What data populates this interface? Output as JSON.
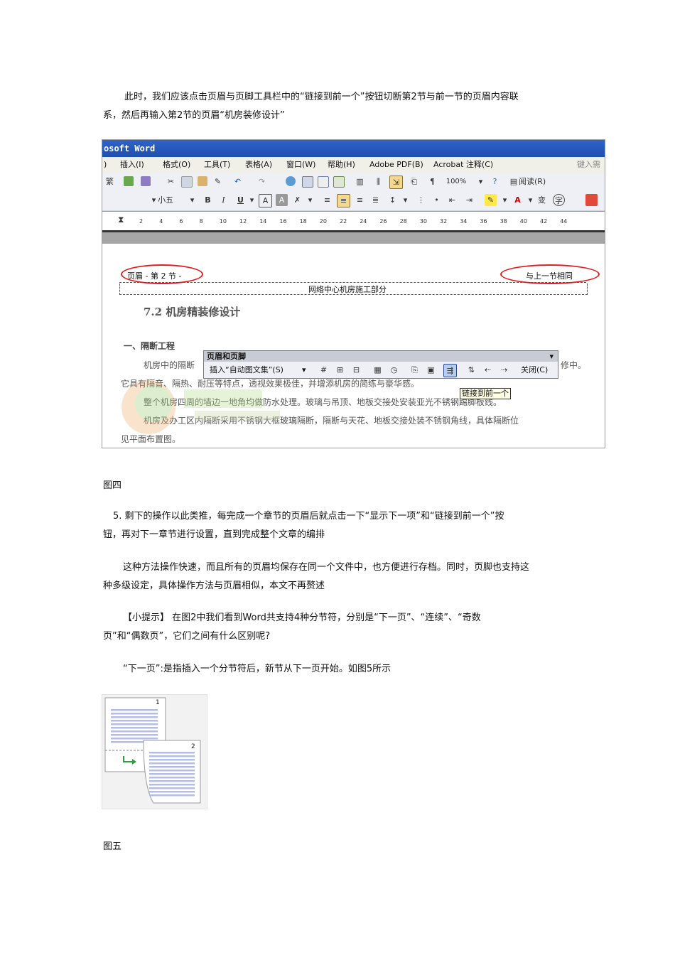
{
  "paragraphs": {
    "p1_line1": "此时，我们应该点击页眉与页脚工具栏中的“链接到前一个”按钮切断第2节与前一节的页眉内容联",
    "p1_line2": "系，然后再输入第2节的页眉“机房装修设计”",
    "caption4": "图四",
    "p2_line1": "5. 剩下的操作以此类推，每完成一个章节的页眉后就点击一下“显示下一项”和“链接到前一个”按",
    "p2_line2": "钮，再对下一章节进行设置，直到完成整个文章的编排",
    "p3_line1": "这种方法操作快速，而且所有的页眉均保存在同一个文件中，也方便进行存档。同时，页脚也支持这",
    "p3_line2": "种多级设定，具体操作方法与页眉相似，本文不再赘述",
    "p4_line1": "【小提示】 在图2中我们看到Word共支持4种分节符，分别是“下一页”、“连续”、“奇数",
    "p4_line2": "页”和“偶数页”，它们之间有什么区别呢?",
    "p5": "“下一页”:是指插入一个分节符后，新节从下一页开始。如图5所示",
    "caption5": "图五"
  },
  "word_screenshot": {
    "title": "osoft Word",
    "menu": [
      "插入(I)",
      "格式(O)",
      "工具(T)",
      "表格(A)",
      "窗口(W)",
      "帮助(H)",
      "Adobe PDF(B)",
      "Acrobat 注释(C)",
      "键入需"
    ],
    "zoom": "100%",
    "read_button": "阅读(R)",
    "font_size": "小五",
    "ruler_ticks": [
      "2",
      "4",
      "6",
      "8",
      "10",
      "12",
      "14",
      "16",
      "18",
      "20",
      "22",
      "24",
      "26",
      "28",
      "30",
      "32",
      "34",
      "36",
      "38",
      "40",
      "42",
      "44"
    ],
    "header_left": "页眉 - 第 2 节 -",
    "header_right": "与上一节相同",
    "header_text": "网络中心机房施工部分",
    "heading": "7.2 机房精装修设计",
    "section": "一、隔断工程",
    "body_lines": [
      "机房中的隔断",
      "修中。",
      "它具有隔音、隔热、耐压等特点，透视效果极佳，并增添机房的简练与豪华感。",
      "整个机房四周的墙边一地角均做防水处理。玻璃与吊顶、地板交接处安装亚光不锈钢踢脚板线。",
      "机房及办工区内隔断采用不锈钢大框玻璃隔断，隔断与天花、地板交接处装不锈钢角线，具体隔断位",
      "见平面布置图。"
    ],
    "toolbar_title": "页眉和页脚",
    "insert_autotext": "插入“自动图文集”(S)",
    "close": "关闭(C)",
    "tooltip": "链接到前一个"
  },
  "figure5": {
    "page1": "1",
    "page2": "2"
  },
  "colors": {
    "titlebar": "#2f63c9",
    "oval": "#e02020",
    "fig_lines": "#b4bce8"
  }
}
